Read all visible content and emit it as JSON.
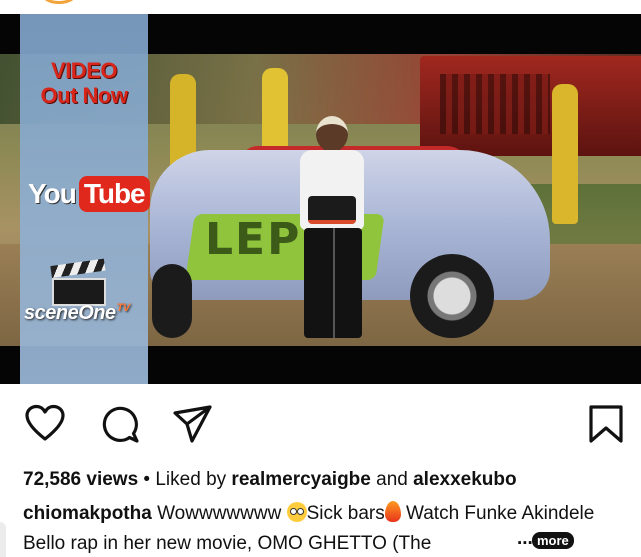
{
  "post": {
    "media": {
      "overlay_video_out": "VIDEO\nOut Now",
      "youtube_you": "You",
      "youtube_tube": "Tube",
      "brand_scene": "scene",
      "brand_one": "One",
      "brand_tv": "TV",
      "graffiti_text": "LEP"
    },
    "actions": {
      "like_icon": "heart-icon",
      "comment_icon": "comment-icon",
      "share_icon": "paper-plane-icon",
      "save_icon": "bookmark-icon"
    },
    "stats": {
      "views": "72,586 views",
      "separator": " • Liked by ",
      "liked_by_1": "realmercyaigbe",
      "and": " and ",
      "liked_by_2": "alexxekubo"
    },
    "caption": {
      "username": "chiomakpotha",
      "text_1": " Wowwwwwww ",
      "emoji_1": "flushed-face",
      "text_2": "Sick bars",
      "emoji_2": "fire",
      "text_3": " Watch Funke Akindele Bello rap in her new movie, OMO GHETTO (The",
      "ellipsis": "...",
      "more_label": "more"
    }
  },
  "colors": {
    "youtube_red": "#e0281c",
    "video_out_red": "#d8261a",
    "panel_blue": "#8fb0d2"
  }
}
